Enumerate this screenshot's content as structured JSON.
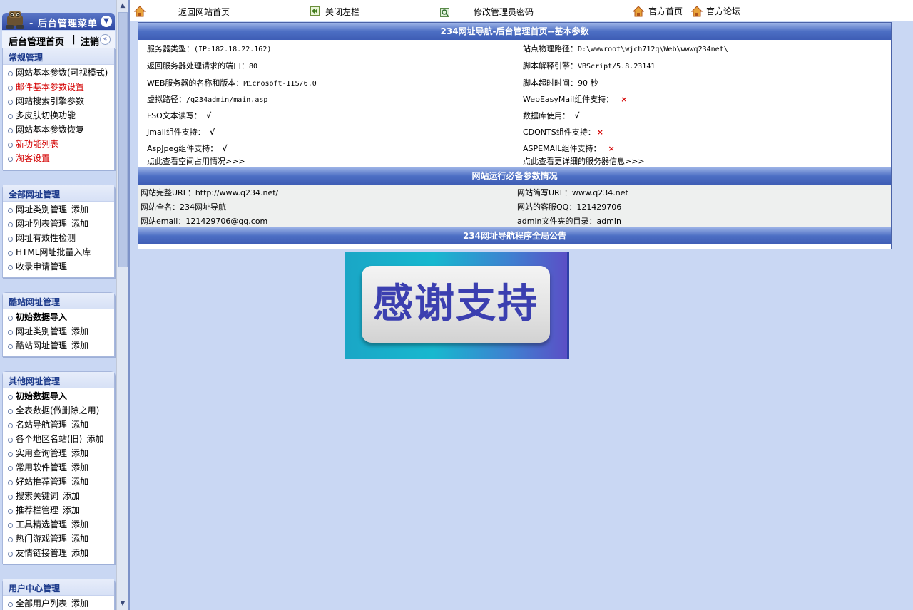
{
  "sidebar": {
    "header_title": "- 后台管理菜单",
    "home_label": "后台管理首页",
    "separator": "|",
    "logout_label": "注销",
    "groups": [
      {
        "title": "常规管理",
        "items": [
          {
            "label": "网站基本参数(可视模式)"
          },
          {
            "label": "邮件基本参数设置"
          },
          {
            "label": "网站搜索引擎参数"
          },
          {
            "label": "多皮肤切换功能"
          },
          {
            "label": "网站基本参数恢复"
          },
          {
            "label": "新功能列表"
          },
          {
            "label": "淘客设置"
          }
        ]
      },
      {
        "title": "全部网址管理",
        "items": [
          {
            "label": "网址类别管理",
            "add": "添加"
          },
          {
            "label": "网址列表管理",
            "add": "添加"
          },
          {
            "label": "网址有效性检测"
          },
          {
            "label": "HTML网址批量入库"
          },
          {
            "label": "收录申请管理"
          }
        ]
      },
      {
        "title": "酷站网址管理",
        "items": [
          {
            "label": "初始数据导入"
          },
          {
            "label": "网址类别管理",
            "add": "添加"
          },
          {
            "label": "酷站网址管理",
            "add": "添加"
          }
        ]
      },
      {
        "title": "其他网址管理",
        "items": [
          {
            "label": "初始数据导入"
          },
          {
            "label": "全表数据(做删除之用)"
          },
          {
            "label": "名站导航管理",
            "add": "添加"
          },
          {
            "label": "各个地区名站(旧)",
            "add": "添加"
          },
          {
            "label": "实用查询管理",
            "add": "添加"
          },
          {
            "label": "常用软件管理",
            "add": "添加"
          },
          {
            "label": "好站推荐管理",
            "add": "添加"
          },
          {
            "label": "搜索关键词",
            "add": "添加"
          },
          {
            "label": "推荐栏管理",
            "add": "添加"
          },
          {
            "label": "工具精选管理",
            "add": "添加"
          },
          {
            "label": "热门游戏管理",
            "add": "添加"
          },
          {
            "label": "友情链接管理",
            "add": "添加"
          }
        ]
      },
      {
        "title": "用户中心管理",
        "items": [
          {
            "label": "全部用户列表",
            "add": "添加"
          }
        ]
      }
    ]
  },
  "toolbar": {
    "back_home": "返回网站首页",
    "close_left": "关闭左栏",
    "change_password": "修改管理员密码",
    "official_home": "官方首页",
    "official_forum": "官方论坛"
  },
  "main": {
    "panel_title": "234网址导航-后台管理首页--基本参数",
    "server_type_label": "服务器类型：",
    "server_type_value": "(IP:182.18.22.162)",
    "site_path_label": "站点物理路径：",
    "site_path_value": "D:\\wwwroot\\wjch712q\\Web\\wwwq234net\\",
    "port_label": "返回服务器处理请求的端口：",
    "port_value": "80",
    "script_engine_label": "脚本解释引擎：",
    "script_engine_value": "VBScript/5.8.23141",
    "web_server_label": "WEB服务器的名称和版本：",
    "web_server_value": "Microsoft-IIS/6.0",
    "script_timeout_label": "脚本超时时间：",
    "script_timeout_value": "90 秒",
    "virtual_path_label": "虚拟路径：",
    "virtual_path_value": "/q234admin/main.asp",
    "webeasymail_label": "WebEasyMail组件支持：",
    "webeasymail_value": "×",
    "fso_label": "FSO文本读写：",
    "fso_value": "√",
    "db_label": "数据库使用：",
    "db_value": "√",
    "jmail_label": "Jmail组件支持：",
    "jmail_value": "√",
    "cdonts_label": "CDONTS组件支持：",
    "cdonts_value": "×",
    "aspjpeg_label": "AspJpeg组件支持：",
    "aspjpeg_value": "√",
    "aspemail_label": "ASPEMAIL组件支持：",
    "aspemail_value": "×",
    "space_link": "点此查看空间占用情况>>>",
    "server_info_link": "点此查看更详细的服务器信息>>>",
    "section2_title": "网站运行必备参数情况",
    "full_url": "网站完整URL：http://www.q234.net/",
    "short_url": "网站简写URL：www.q234.net",
    "full_name": "网站全名：234网址导航",
    "service_qq": "网站的客服QQ：121429706",
    "email": "网站email：121429706@qq.com",
    "admin_dir": "admin文件夹的目录：admin",
    "section3_title": "234网址导航程序全局公告"
  },
  "banner": {
    "text": "感谢支持"
  },
  "colors": {
    "page_bg": "#c9d7f3",
    "title_bar": "#4d6fc4",
    "red_text": "#d40000",
    "group_title": "#1d3b8c"
  }
}
